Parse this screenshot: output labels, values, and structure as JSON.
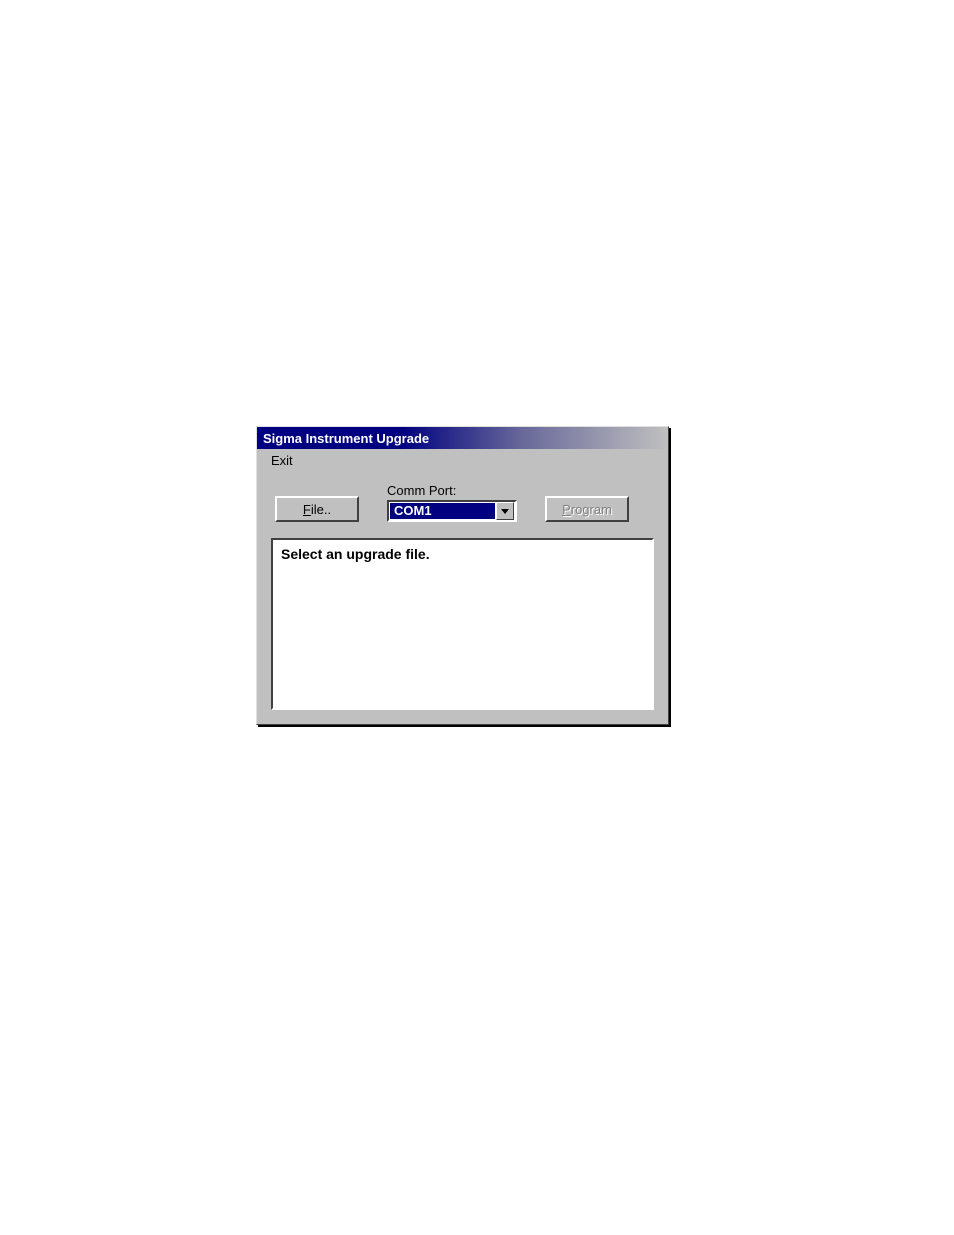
{
  "dialog": {
    "title": "Sigma Instrument Upgrade",
    "menu": {
      "exit": "Exit"
    },
    "controls": {
      "file_button": "File..",
      "comm_label": "Comm Port:",
      "comm_selected": "COM1",
      "program_button": "Program"
    },
    "status_text": "Select an upgrade file."
  }
}
